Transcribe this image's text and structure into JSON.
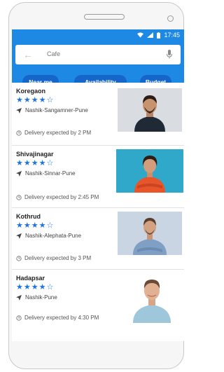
{
  "status_bar": {
    "time": "17:45",
    "icons": [
      "wifi-icon",
      "signal-icon",
      "battery-icon"
    ]
  },
  "search": {
    "placeholder": "Cafe",
    "back_icon": "arrow-left-icon",
    "mic_icon": "microphone-icon"
  },
  "filters": [
    {
      "label": "Near me"
    },
    {
      "label": "Availability"
    },
    {
      "label": "Budget"
    }
  ],
  "results": [
    {
      "title": "Koregaon",
      "rating": 4,
      "route": "Nashik-Sangamner-Pune",
      "delivery": "Delivery expected by 2 PM"
    },
    {
      "title": "Shivajinagar",
      "rating": 4,
      "route": "Nashik-Sinnar-Pune",
      "delivery": "Delivery expected by 2:45 PM"
    },
    {
      "title": "Kothrud",
      "rating": 4,
      "route": "Nashik-Alephata-Pune",
      "delivery": "Delivery expected by 3 PM"
    },
    {
      "title": "Hadapsar",
      "rating": 4,
      "route": "Nashik-Pune",
      "delivery": "Delivery expected by 4:30 PM"
    }
  ],
  "colors": {
    "primary": "#1e88e5",
    "chip": "#1566c8",
    "star": "#1e74e0"
  }
}
